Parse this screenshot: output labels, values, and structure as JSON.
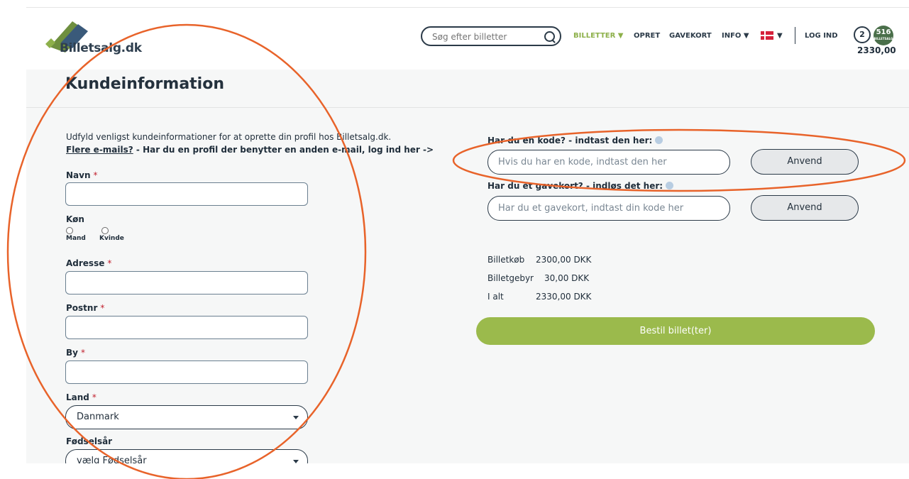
{
  "header": {
    "logo_text": "Billetsalg.dk",
    "search_placeholder": "Søg efter billetter",
    "nav": {
      "billetter": "BILLETTER ▼",
      "opret": "OPRET",
      "gavekort": "GAVEKORT",
      "info": "INFO ▼",
      "lang_caret": "▼",
      "log_ind": "LOG IND"
    },
    "cart_count": "2",
    "badge_number": "516",
    "badge_sub": "BILLETSALG",
    "cart_total": "2330,00"
  },
  "page": {
    "title": "Kundeinformation",
    "intro": "Udfyld venligst kundeinformationer for at oprette din profil hos Billetsalg.dk.",
    "intro_link": "Flere e-mails?",
    "intro_rest": " - Har du en profil der benytter en anden e-mail, log ind her ->"
  },
  "form": {
    "navn_label": "Navn",
    "koen_label": "Køn",
    "mand": "Mand",
    "kvinde": "Kvinde",
    "adresse_label": "Adresse",
    "postnr_label": "Postnr",
    "by_label": "By",
    "land_label": "Land",
    "land_value": "Danmark",
    "foedselsaar_label": "Fødselsår",
    "foedselsaar_value": "vælg Fødselsår",
    "required_mark": "*"
  },
  "codes": {
    "code_label": "Har du en kode? - indtast den her:",
    "code_placeholder": "Hvis du har en kode, indtast den her",
    "code_button": "Anvend",
    "gift_label": "Har du et gavekort? - indløs det her:",
    "gift_placeholder": "Har du et gavekort, indtast din kode her",
    "gift_button": "Anvend"
  },
  "summary": {
    "rows": [
      {
        "label": "Billetkøb",
        "value": "2300,00 DKK"
      },
      {
        "label": "Billetgebyr",
        "value": "30,00 DKK"
      },
      {
        "label": "I alt",
        "value": "2330,00 DKK"
      }
    ],
    "order_button": "Bestil billet(ter)"
  },
  "colors": {
    "accent_green": "#9bba4c",
    "annotation_orange": "#e8632a",
    "text_dark": "#1f2d3a"
  }
}
